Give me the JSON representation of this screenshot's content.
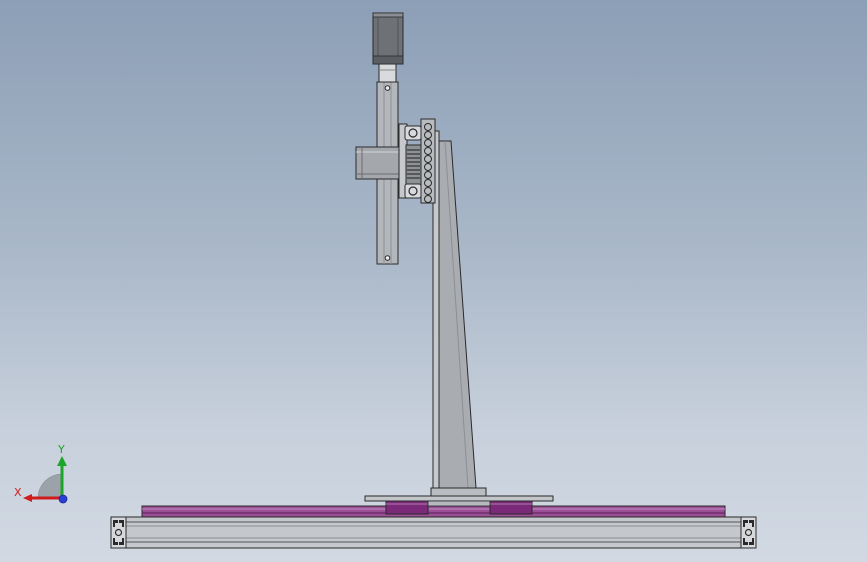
{
  "viewport": {
    "background_top": "#8c9fb6",
    "background_bottom": "#d2d9e3"
  },
  "colors": {
    "metal_light": "#c9cbcf",
    "metal_mid": "#9ea2a8",
    "metal_dark": "#5e6268",
    "outline": "#2a2a2a",
    "rail_purple": "#7a2a78",
    "rail_purple_light": "#a66aa2",
    "motor_body": "#6f7378"
  },
  "triad": {
    "x_label": "X",
    "y_label": "Y",
    "x_color": "#d11c1c",
    "y_color": "#1da52a",
    "z_color": "#2a3fd6"
  }
}
